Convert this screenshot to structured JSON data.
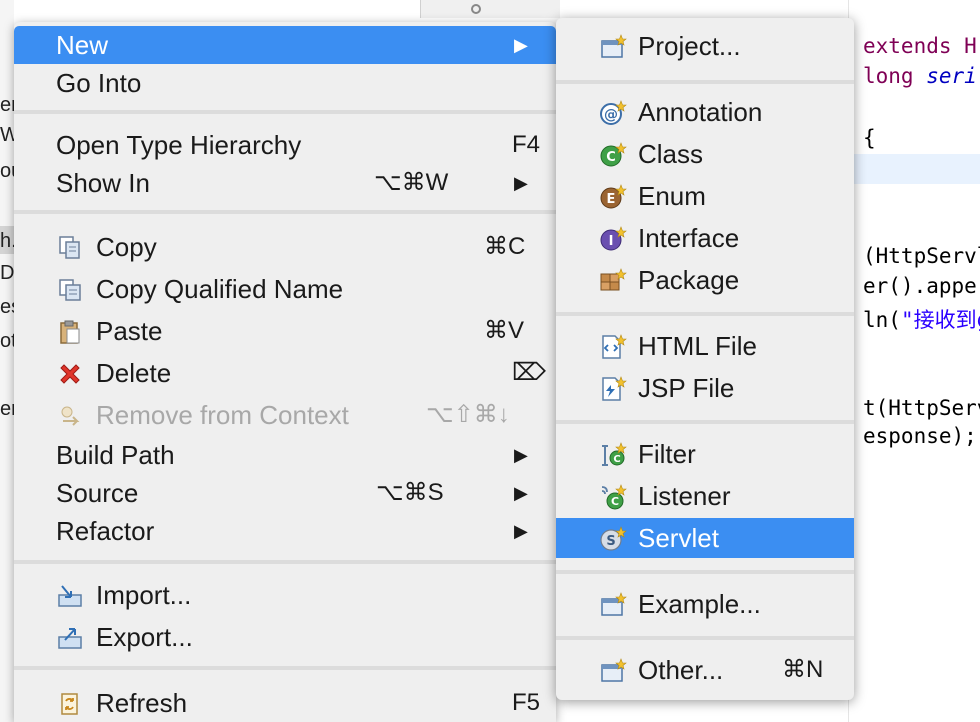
{
  "background": {
    "left_fragments": [
      "en",
      "W",
      "ou",
      "h.",
      "De",
      "es",
      "ot",
      "er"
    ],
    "editor_lines": [
      {
        "parts": [
          {
            "t": "extends H",
            "c": "kw"
          }
        ]
      },
      {
        "parts": [
          {
            "t": "long ",
            "c": "kw"
          },
          {
            "t": "seri",
            "c": "it"
          }
        ]
      },
      {
        "parts": [
          {
            "t": "{",
            "c": ""
          }
        ]
      },
      {
        "parts": [
          {
            "t": "(HttpServl",
            "c": ""
          }
        ]
      },
      {
        "parts": [
          {
            "t": "er().apper",
            "c": ""
          }
        ]
      },
      {
        "parts": [
          {
            "t": "ln(",
            "c": ""
          },
          {
            "t": "\"接收到g",
            "c": "str"
          }
        ]
      },
      {
        "parts": [
          {
            "t": "t(HttpServ",
            "c": ""
          }
        ]
      },
      {
        "parts": [
          {
            "t": "esponse);",
            "c": ""
          }
        ]
      }
    ]
  },
  "menu": {
    "items": [
      {
        "label": "New",
        "shortcut": "",
        "arrow": "▶",
        "icon": "",
        "active": true
      },
      {
        "label": "Go Into",
        "shortcut": "",
        "arrow": "",
        "icon": ""
      },
      {
        "label": "Open Type Hierarchy",
        "shortcut": "F4",
        "arrow": "",
        "icon": ""
      },
      {
        "label": "Show In",
        "shortcut": "⌥⌘W",
        "arrow": "▶",
        "icon": ""
      },
      {
        "label": "Copy",
        "shortcut": "⌘C",
        "arrow": "",
        "icon": "copy-icon"
      },
      {
        "label": "Copy Qualified Name",
        "shortcut": "",
        "arrow": "",
        "icon": "copy-qualified-name-icon"
      },
      {
        "label": "Paste",
        "shortcut": "⌘V",
        "arrow": "",
        "icon": "paste-icon"
      },
      {
        "label": "Delete",
        "shortcut": "⌦",
        "arrow": "",
        "icon": "delete-icon"
      },
      {
        "label": "Remove from Context",
        "shortcut": "⌥⇧⌘↓",
        "arrow": "",
        "icon": "remove-from-context-icon",
        "disabled": true
      },
      {
        "label": "Build Path",
        "shortcut": "",
        "arrow": "▶",
        "icon": ""
      },
      {
        "label": "Source",
        "shortcut": "⌥⌘S",
        "arrow": "▶",
        "icon": ""
      },
      {
        "label": "Refactor",
        "shortcut": "",
        "arrow": "▶",
        "icon": ""
      },
      {
        "label": "Import...",
        "shortcut": "",
        "arrow": "",
        "icon": "import-icon"
      },
      {
        "label": "Export...",
        "shortcut": "",
        "arrow": "",
        "icon": "export-icon"
      },
      {
        "label": "Refresh",
        "shortcut": "F5",
        "arrow": "",
        "icon": "refresh-icon"
      }
    ]
  },
  "submenu": {
    "items": [
      {
        "label": "Project...",
        "icon": "project-icon",
        "shortcut": ""
      },
      {
        "label": "Annotation",
        "icon": "annotation-icon",
        "shortcut": ""
      },
      {
        "label": "Class",
        "icon": "class-icon",
        "shortcut": ""
      },
      {
        "label": "Enum",
        "icon": "enum-icon",
        "shortcut": ""
      },
      {
        "label": "Interface",
        "icon": "interface-icon",
        "shortcut": ""
      },
      {
        "label": "Package",
        "icon": "package-icon",
        "shortcut": ""
      },
      {
        "label": "HTML File",
        "icon": "html-file-icon",
        "shortcut": ""
      },
      {
        "label": "JSP File",
        "icon": "jsp-file-icon",
        "shortcut": ""
      },
      {
        "label": "Filter",
        "icon": "filter-icon",
        "shortcut": ""
      },
      {
        "label": "Listener",
        "icon": "listener-icon",
        "shortcut": ""
      },
      {
        "label": "Servlet",
        "icon": "servlet-icon",
        "shortcut": "",
        "active": true
      },
      {
        "label": "Example...",
        "icon": "example-icon",
        "shortcut": ""
      },
      {
        "label": "Other...",
        "icon": "other-icon",
        "shortcut": "⌘N"
      }
    ]
  },
  "colors": {
    "highlight": "#3b8ef2",
    "menu_bg": "#efefef",
    "separator": "#dcdcdc",
    "disabled_text": "#a8a8a8",
    "keyword": "#7f0055",
    "string": "#2a00ff"
  }
}
